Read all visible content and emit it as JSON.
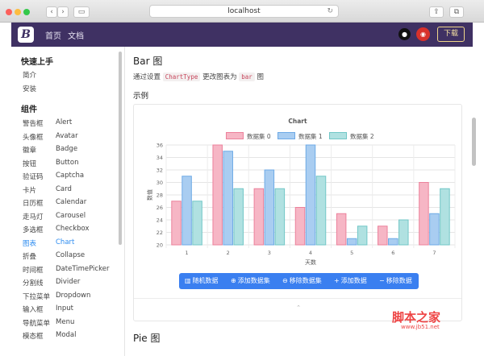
{
  "browser": {
    "url": "localhost",
    "back": "‹",
    "forward": "›",
    "sidebar_toggle": "▭",
    "reload": "↻",
    "share": "⇪",
    "tabs": "⧉"
  },
  "navbar": {
    "logo": "B",
    "links": [
      "首页",
      "文档"
    ],
    "download": "下载"
  },
  "sidebar": {
    "groups": [
      {
        "title": "快速上手",
        "items": [
          "简介",
          "安装"
        ]
      },
      {
        "title": "组件"
      }
    ],
    "components": [
      {
        "cn": "警告框",
        "en": "Alert"
      },
      {
        "cn": "头像框",
        "en": "Avatar"
      },
      {
        "cn": "徽章",
        "en": "Badge"
      },
      {
        "cn": "按钮",
        "en": "Button"
      },
      {
        "cn": "验证码",
        "en": "Captcha"
      },
      {
        "cn": "卡片",
        "en": "Card"
      },
      {
        "cn": "日历框",
        "en": "Calendar"
      },
      {
        "cn": "走马灯",
        "en": "Carousel"
      },
      {
        "cn": "多选框",
        "en": "Checkbox"
      },
      {
        "cn": "图表",
        "en": "Chart",
        "active": true
      },
      {
        "cn": "折叠",
        "en": "Collapse"
      },
      {
        "cn": "时间框",
        "en": "DateTimePicker"
      },
      {
        "cn": "分割线",
        "en": "Divider"
      },
      {
        "cn": "下拉菜单",
        "en": "Dropdown"
      },
      {
        "cn": "输入框",
        "en": "Input"
      },
      {
        "cn": "导航菜单",
        "en": "Menu"
      },
      {
        "cn": "模态框",
        "en": "Modal"
      }
    ]
  },
  "main": {
    "title": "Bar 图",
    "desc_prefix": "通过设置",
    "desc_code1": "ChartType",
    "desc_mid": "更改图表为",
    "desc_code2": "bar",
    "desc_suffix": "图",
    "example_heading": "示例",
    "next_title": "Pie 图",
    "toggle": "⌃"
  },
  "buttons": [
    {
      "label": "随机数据",
      "icon": "chart-icon",
      "glyph": "▥"
    },
    {
      "label": "添加数据集",
      "icon": "plus-circle-icon",
      "glyph": "⊕"
    },
    {
      "label": "移除数据集",
      "icon": "minus-circle-icon",
      "glyph": "⊖"
    },
    {
      "label": "添加数据",
      "icon": "plus-icon",
      "glyph": "+"
    },
    {
      "label": "移除数据",
      "icon": "minus-icon",
      "glyph": "−"
    }
  ],
  "colors": {
    "navbar": "#3f3163",
    "primary": "#3a7ff0",
    "series": [
      {
        "fill": "#f6b6c5",
        "stroke": "#ec819b"
      },
      {
        "fill": "#a9cdf1",
        "stroke": "#6eaae6"
      },
      {
        "fill": "#b0e1e1",
        "stroke": "#72c7c7"
      }
    ]
  },
  "chart_data": {
    "type": "bar",
    "title": "Chart",
    "xlabel": "天数",
    "ylabel": "数值",
    "categories": [
      "1",
      "2",
      "3",
      "4",
      "5",
      "6",
      "7"
    ],
    "ylim": [
      20,
      36
    ],
    "yticks": [
      "20",
      "22",
      "24",
      "26",
      "28",
      "30",
      "32",
      "34",
      "36"
    ],
    "grid": true,
    "legend_position": "top",
    "series": [
      {
        "name": "数据集 0",
        "values": [
          27,
          36,
          29,
          26,
          25,
          23,
          30
        ]
      },
      {
        "name": "数据集 1",
        "values": [
          31,
          35,
          32,
          36,
          21,
          21,
          25
        ]
      },
      {
        "name": "数据集 2",
        "values": [
          27,
          29,
          29,
          31,
          23,
          24,
          29
        ]
      }
    ]
  },
  "watermark": {
    "main": "脚本之家",
    "sub": "www.jb51.net"
  }
}
